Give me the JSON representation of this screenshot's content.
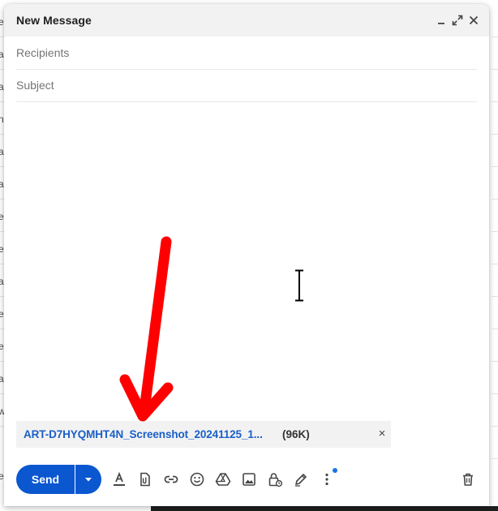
{
  "compose": {
    "title": "New Message",
    "recipients_placeholder": "Recipients",
    "subject_placeholder": "Subject"
  },
  "background_letters": [
    "e",
    "a",
    "a",
    "n",
    "a",
    "a",
    "e",
    "e",
    "a",
    "e",
    "e",
    "a",
    "w",
    "e"
  ],
  "attachment": {
    "name": "ART-D7HYQMHT4N_Screenshot_20241125_1...",
    "size": "(96K)",
    "close_glyph": "×"
  },
  "toolbar": {
    "send_label": "Send",
    "icons": [
      "formatting-options-icon",
      "attach-file-icon",
      "insert-link-icon",
      "insert-emoji-icon",
      "insert-drive-icon",
      "insert-photo-icon",
      "confidential-mode-icon",
      "insert-signature-icon",
      "more-options-icon",
      "discard-draft-icon"
    ]
  },
  "colors": {
    "accent": "#0b57d0",
    "attachment_link": "#1a5fc7",
    "annotation_arrow": "#ff0000",
    "notification_dot": "#1a73e8"
  }
}
